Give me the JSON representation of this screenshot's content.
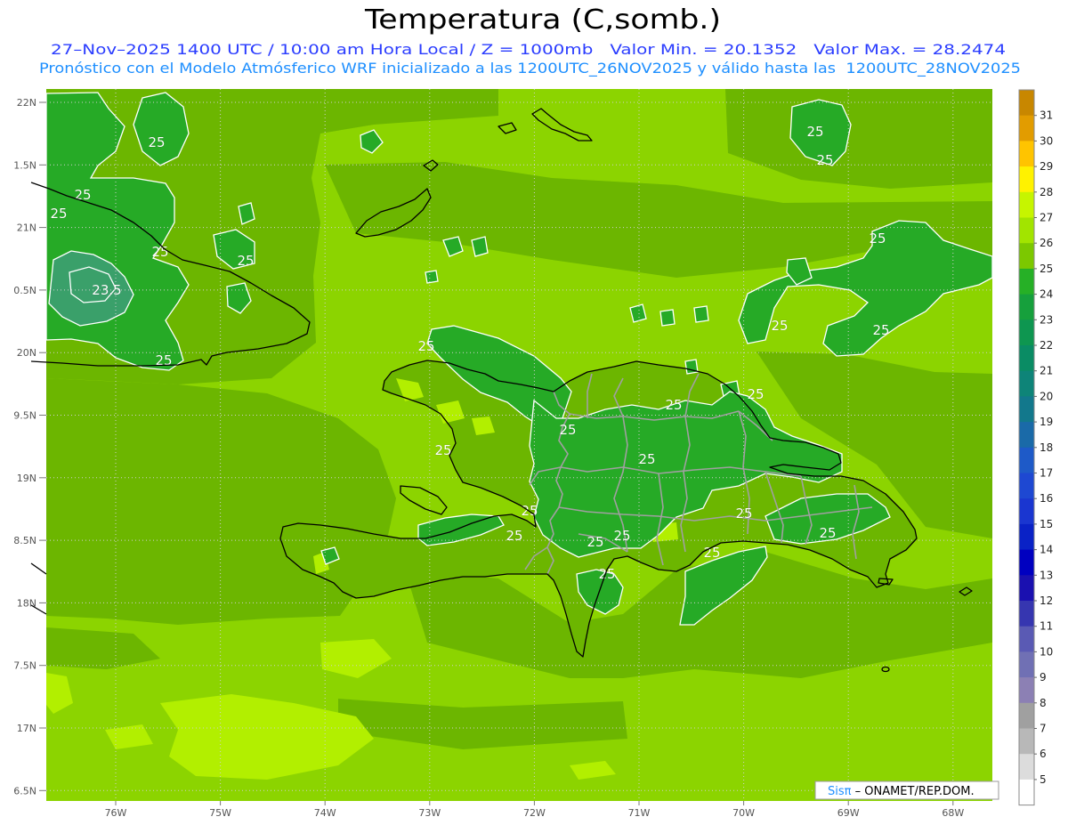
{
  "title": "Temperatura (C,somb.)",
  "header": {
    "line1": "27–Nov–2025 1400 UTC / 10:00 am Hora Local / Z = 1000mb   Valor Min. = 20.1352   Valor Max. = 28.2474",
    "line2": "Pronóstico con el Modelo Atmósferico WRF inicializado a las 1200UTC_26NOV2025 y válido hasta las  1200UTC_28NOV2025"
  },
  "axes": {
    "lat_labels": [
      "22N",
      "1.5N",
      "21N",
      "0.5N",
      "20N",
      "9.5N",
      "19N",
      "8.5N",
      "18N",
      "7.5N",
      "17N",
      "6.5N"
    ],
    "lon_labels": [
      "76W",
      "75W",
      "74W",
      "73W",
      "72W",
      "71W",
      "70W",
      "69W",
      "68W"
    ]
  },
  "colorbar": {
    "labels": [
      "31",
      "30",
      "29",
      "28",
      "27",
      "26",
      "25",
      "24",
      "23",
      "22",
      "21",
      "20",
      "19",
      "18",
      "17",
      "16",
      "15",
      "14",
      "13",
      "12",
      "11",
      "10",
      "9",
      "8",
      "7",
      "6",
      "5"
    ],
    "colors": [
      "#c88700",
      "#e29c00",
      "#ffc400",
      "#fff200",
      "#c6f500",
      "#a2e400",
      "#7cc800",
      "#26b026",
      "#16a03c",
      "#0e9650",
      "#0a8c64",
      "#0e8478",
      "#12788c",
      "#1a6aa8",
      "#1e5ac8",
      "#1e48d2",
      "#1a36d0",
      "#0a22c6",
      "#0000c0",
      "#1a10b0",
      "#3636b0",
      "#5a5ab4",
      "#7070b4",
      "#8c80b4",
      "#a0a0a0",
      "#b8b8b8",
      "#dcdcdc",
      "#ffffff"
    ]
  },
  "field_colors": {
    "t27_28": "#b2ef00",
    "t28_29": "#eaff00",
    "t26_27": "#8cd400",
    "t25_26": "#6cb600",
    "t24_25": "#26aa26",
    "t23_24": "#3aa06a"
  },
  "contour_labels": {
    "main": "25",
    "inner": "23.5"
  },
  "credit": {
    "brand": "Sisπ",
    "text": " – ONAMET/REP.DOM."
  },
  "colors": {
    "header_line1": "#2a3cff",
    "header_line2": "#1e8fff",
    "credit_brand": "#1e8fff",
    "credit_text": "#000000"
  }
}
